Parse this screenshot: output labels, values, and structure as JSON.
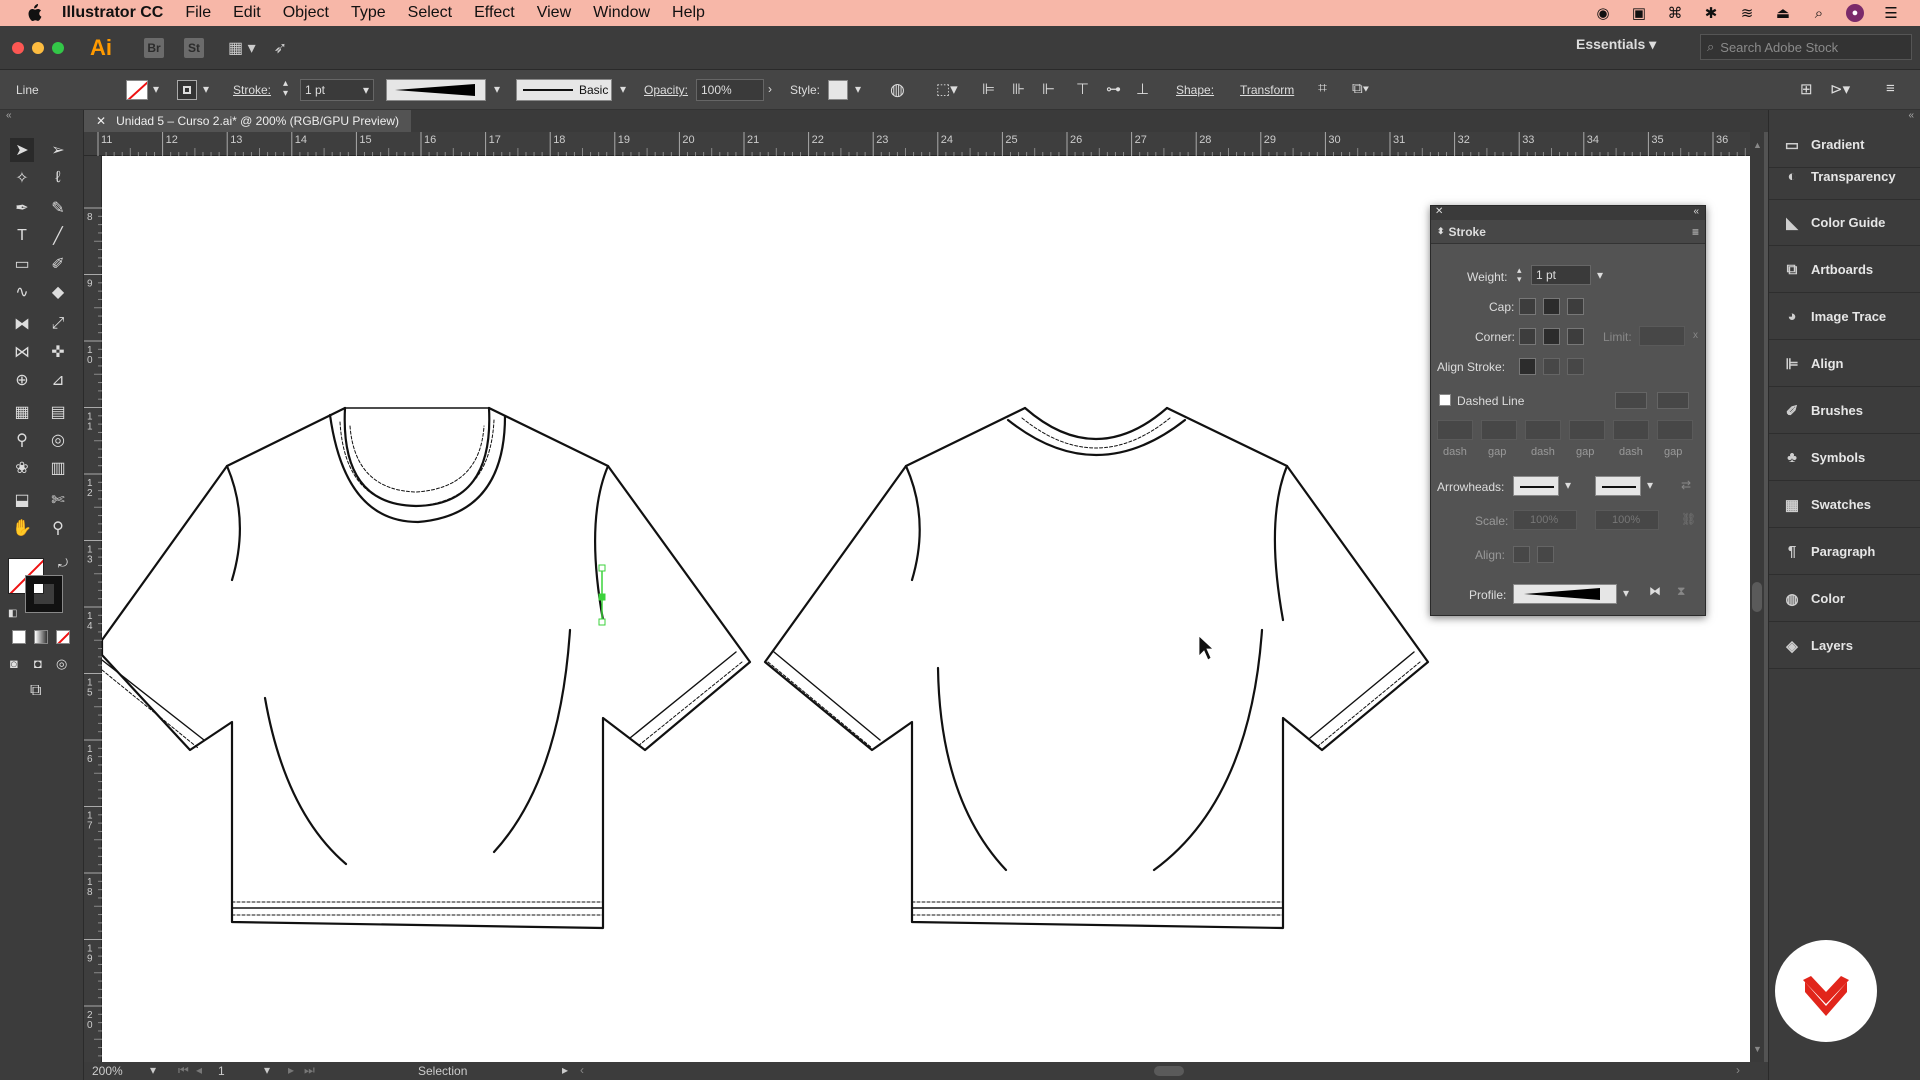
{
  "menubar": {
    "app_name": "Illustrator CC",
    "items": [
      "File",
      "Edit",
      "Object",
      "Type",
      "Select",
      "Effect",
      "View",
      "Window",
      "Help"
    ]
  },
  "appbar": {
    "logo": "Ai",
    "bridge": "Br",
    "stock": "St",
    "workspace": "Essentials",
    "search_placeholder": "Search Adobe Stock"
  },
  "control": {
    "selection_type": "Line",
    "stroke_label": "Stroke:",
    "stroke_weight": "1 pt",
    "brush_label": "Basic",
    "opacity_label": "Opacity:",
    "opacity_value": "100%",
    "style_label": "Style:",
    "shape_label": "Shape:",
    "transform_label": "Transform"
  },
  "document": {
    "tab_title": "Unidad 5  – Curso 2.ai* @ 200% (RGB/GPU Preview)"
  },
  "rulers": {
    "top_ticks": [
      "11",
      "12",
      "13",
      "14",
      "15",
      "16",
      "17",
      "18",
      "19",
      "20",
      "21",
      "22",
      "23",
      "24",
      "25",
      "26",
      "27",
      "28",
      "29",
      "30",
      "31",
      "32",
      "33",
      "34",
      "35",
      "36"
    ],
    "left_ticks": [
      "8",
      "9",
      "10",
      "11",
      "12",
      "13",
      "14",
      "15",
      "16",
      "17",
      "18",
      "19",
      "20"
    ]
  },
  "status": {
    "zoom": "200%",
    "artboard": "1",
    "tool": "Selection"
  },
  "stroke_panel": {
    "title": "Stroke",
    "weight_label": "Weight:",
    "weight_value": "1 pt",
    "cap_label": "Cap:",
    "corner_label": "Corner:",
    "limit_label": "Limit:",
    "align_label": "Align Stroke:",
    "dashed_label": "Dashed Line",
    "dash_labels": [
      "dash",
      "gap",
      "dash",
      "gap",
      "dash",
      "gap"
    ],
    "arrowheads_label": "Arrowheads:",
    "scale_label": "Scale:",
    "scale_value_1": "100%",
    "scale_value_2": "100%",
    "align_arrow_label": "Align:",
    "profile_label": "Profile:"
  },
  "dock": {
    "items": [
      {
        "label": "Gradient",
        "icon": "gradient-icon"
      },
      {
        "label": "Transparency",
        "icon": "transparency-icon"
      },
      {
        "label": "Color Guide",
        "icon": "color-guide-icon"
      },
      {
        "label": "Artboards",
        "icon": "artboards-icon"
      },
      {
        "label": "Image Trace",
        "icon": "image-trace-icon"
      },
      {
        "label": "Align",
        "icon": "align-icon"
      },
      {
        "label": "Brushes",
        "icon": "brushes-icon"
      },
      {
        "label": "Symbols",
        "icon": "symbols-icon"
      },
      {
        "label": "Swatches",
        "icon": "swatches-icon"
      },
      {
        "label": "Paragraph",
        "icon": "paragraph-icon"
      },
      {
        "label": "Color",
        "icon": "color-icon"
      },
      {
        "label": "Layers",
        "icon": "layers-icon"
      }
    ]
  },
  "colors": {
    "menubar": "#f7b7a8",
    "ui_dark": "#3c3c3c",
    "ui_mid": "#535353",
    "accent_orange": "#ff9a00",
    "brand_red": "#e1251b",
    "selection_green": "#3bd23b"
  }
}
